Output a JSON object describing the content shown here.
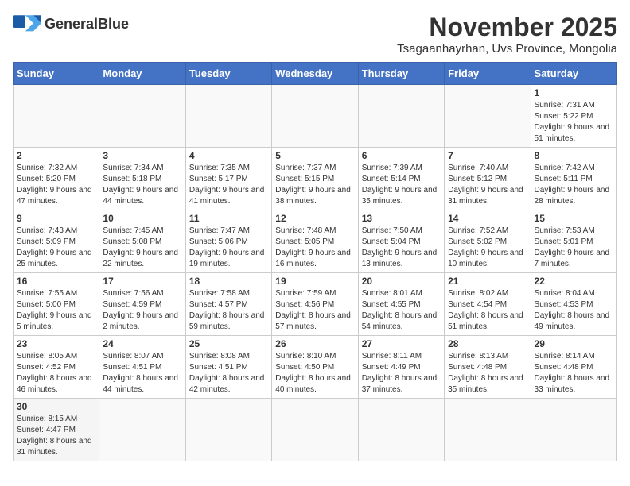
{
  "header": {
    "logo_text_normal": "General",
    "logo_text_bold": "Blue",
    "month_title": "November 2025",
    "subtitle": "Tsagaanhayrhan, Uvs Province, Mongolia"
  },
  "weekdays": [
    "Sunday",
    "Monday",
    "Tuesday",
    "Wednesday",
    "Thursday",
    "Friday",
    "Saturday"
  ],
  "weeks": [
    [
      {
        "day": "",
        "info": ""
      },
      {
        "day": "",
        "info": ""
      },
      {
        "day": "",
        "info": ""
      },
      {
        "day": "",
        "info": ""
      },
      {
        "day": "",
        "info": ""
      },
      {
        "day": "",
        "info": ""
      },
      {
        "day": "1",
        "info": "Sunrise: 7:31 AM\nSunset: 5:22 PM\nDaylight: 9 hours and 51 minutes."
      }
    ],
    [
      {
        "day": "2",
        "info": "Sunrise: 7:32 AM\nSunset: 5:20 PM\nDaylight: 9 hours and 47 minutes."
      },
      {
        "day": "3",
        "info": "Sunrise: 7:34 AM\nSunset: 5:18 PM\nDaylight: 9 hours and 44 minutes."
      },
      {
        "day": "4",
        "info": "Sunrise: 7:35 AM\nSunset: 5:17 PM\nDaylight: 9 hours and 41 minutes."
      },
      {
        "day": "5",
        "info": "Sunrise: 7:37 AM\nSunset: 5:15 PM\nDaylight: 9 hours and 38 minutes."
      },
      {
        "day": "6",
        "info": "Sunrise: 7:39 AM\nSunset: 5:14 PM\nDaylight: 9 hours and 35 minutes."
      },
      {
        "day": "7",
        "info": "Sunrise: 7:40 AM\nSunset: 5:12 PM\nDaylight: 9 hours and 31 minutes."
      },
      {
        "day": "8",
        "info": "Sunrise: 7:42 AM\nSunset: 5:11 PM\nDaylight: 9 hours and 28 minutes."
      }
    ],
    [
      {
        "day": "9",
        "info": "Sunrise: 7:43 AM\nSunset: 5:09 PM\nDaylight: 9 hours and 25 minutes."
      },
      {
        "day": "10",
        "info": "Sunrise: 7:45 AM\nSunset: 5:08 PM\nDaylight: 9 hours and 22 minutes."
      },
      {
        "day": "11",
        "info": "Sunrise: 7:47 AM\nSunset: 5:06 PM\nDaylight: 9 hours and 19 minutes."
      },
      {
        "day": "12",
        "info": "Sunrise: 7:48 AM\nSunset: 5:05 PM\nDaylight: 9 hours and 16 minutes."
      },
      {
        "day": "13",
        "info": "Sunrise: 7:50 AM\nSunset: 5:04 PM\nDaylight: 9 hours and 13 minutes."
      },
      {
        "day": "14",
        "info": "Sunrise: 7:52 AM\nSunset: 5:02 PM\nDaylight: 9 hours and 10 minutes."
      },
      {
        "day": "15",
        "info": "Sunrise: 7:53 AM\nSunset: 5:01 PM\nDaylight: 9 hours and 7 minutes."
      }
    ],
    [
      {
        "day": "16",
        "info": "Sunrise: 7:55 AM\nSunset: 5:00 PM\nDaylight: 9 hours and 5 minutes."
      },
      {
        "day": "17",
        "info": "Sunrise: 7:56 AM\nSunset: 4:59 PM\nDaylight: 9 hours and 2 minutes."
      },
      {
        "day": "18",
        "info": "Sunrise: 7:58 AM\nSunset: 4:57 PM\nDaylight: 8 hours and 59 minutes."
      },
      {
        "day": "19",
        "info": "Sunrise: 7:59 AM\nSunset: 4:56 PM\nDaylight: 8 hours and 57 minutes."
      },
      {
        "day": "20",
        "info": "Sunrise: 8:01 AM\nSunset: 4:55 PM\nDaylight: 8 hours and 54 minutes."
      },
      {
        "day": "21",
        "info": "Sunrise: 8:02 AM\nSunset: 4:54 PM\nDaylight: 8 hours and 51 minutes."
      },
      {
        "day": "22",
        "info": "Sunrise: 8:04 AM\nSunset: 4:53 PM\nDaylight: 8 hours and 49 minutes."
      }
    ],
    [
      {
        "day": "23",
        "info": "Sunrise: 8:05 AM\nSunset: 4:52 PM\nDaylight: 8 hours and 46 minutes."
      },
      {
        "day": "24",
        "info": "Sunrise: 8:07 AM\nSunset: 4:51 PM\nDaylight: 8 hours and 44 minutes."
      },
      {
        "day": "25",
        "info": "Sunrise: 8:08 AM\nSunset: 4:51 PM\nDaylight: 8 hours and 42 minutes."
      },
      {
        "day": "26",
        "info": "Sunrise: 8:10 AM\nSunset: 4:50 PM\nDaylight: 8 hours and 40 minutes."
      },
      {
        "day": "27",
        "info": "Sunrise: 8:11 AM\nSunset: 4:49 PM\nDaylight: 8 hours and 37 minutes."
      },
      {
        "day": "28",
        "info": "Sunrise: 8:13 AM\nSunset: 4:48 PM\nDaylight: 8 hours and 35 minutes."
      },
      {
        "day": "29",
        "info": "Sunrise: 8:14 AM\nSunset: 4:48 PM\nDaylight: 8 hours and 33 minutes."
      }
    ],
    [
      {
        "day": "30",
        "info": "Sunrise: 8:15 AM\nSunset: 4:47 PM\nDaylight: 8 hours and 31 minutes."
      },
      {
        "day": "",
        "info": ""
      },
      {
        "day": "",
        "info": ""
      },
      {
        "day": "",
        "info": ""
      },
      {
        "day": "",
        "info": ""
      },
      {
        "day": "",
        "info": ""
      },
      {
        "day": "",
        "info": ""
      }
    ]
  ]
}
